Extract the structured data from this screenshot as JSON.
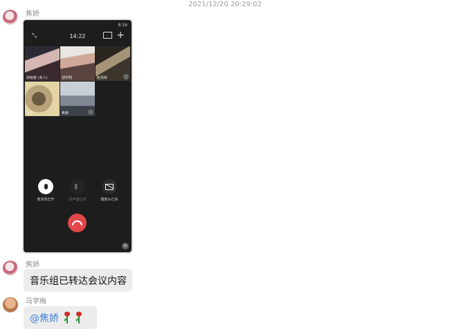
{
  "timestamp": "2021/12/20 20:29:02",
  "messages": [
    {
      "sender": "焦娇",
      "type": "image"
    },
    {
      "sender": "焦娇",
      "text": "音乐组已转达会议内容"
    },
    {
      "sender": "马学梅",
      "mention": "@焦娇",
      "emoji": [
        "rose-icon",
        "rose-icon"
      ]
    }
  ],
  "call_screenshot": {
    "status_time": "8:16",
    "timer": "14:22",
    "participants": [
      {
        "name": "孙晓雯 (本人)"
      },
      {
        "name": "邬宇明"
      },
      {
        "name": "赵清秋"
      },
      {
        "name": "马学"
      },
      {
        "name": "焦娇"
      }
    ],
    "controls": {
      "mic": "麦克风已开",
      "speaker": "扬声器已关",
      "camera": "摄像头已关"
    }
  }
}
